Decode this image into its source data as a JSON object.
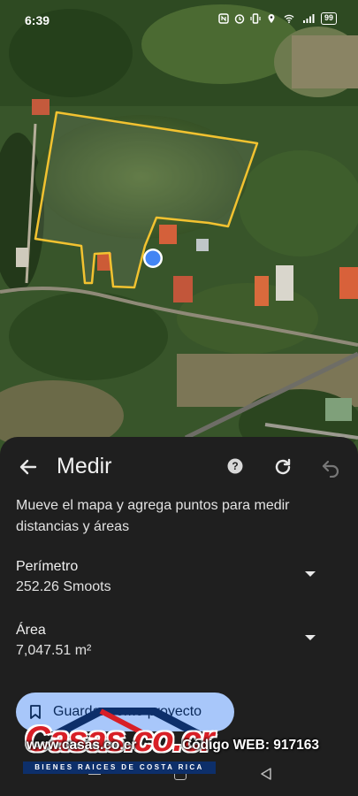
{
  "status_bar": {
    "time": "6:39",
    "battery": "99",
    "icons": [
      "nfc-icon",
      "alarm-icon",
      "vibrate-icon",
      "location-icon",
      "wifi-icon",
      "signal-icon",
      "battery-icon"
    ]
  },
  "measure": {
    "title": "Medir",
    "instructions": "Mueve el mapa y agrega puntos para medir distancias y áreas",
    "perimeter": {
      "label": "Perímetro",
      "value": "252.26 Smoots"
    },
    "area": {
      "label": "Área",
      "value": "7,047.51 m²"
    },
    "save_button_label": "Guardar como proyecto"
  },
  "watermark": {
    "brand": "Casas.co.cr",
    "tagline": "BIENES RAICES DE COSTA RICA",
    "url": "www.casas.co.cr",
    "code": "Código WEB: 917163"
  },
  "colors": {
    "sheet_background": "#1f1f1f",
    "outline": "#f2c230",
    "accent_button": "#a8c7fa",
    "location_dot": "#4285f4"
  }
}
